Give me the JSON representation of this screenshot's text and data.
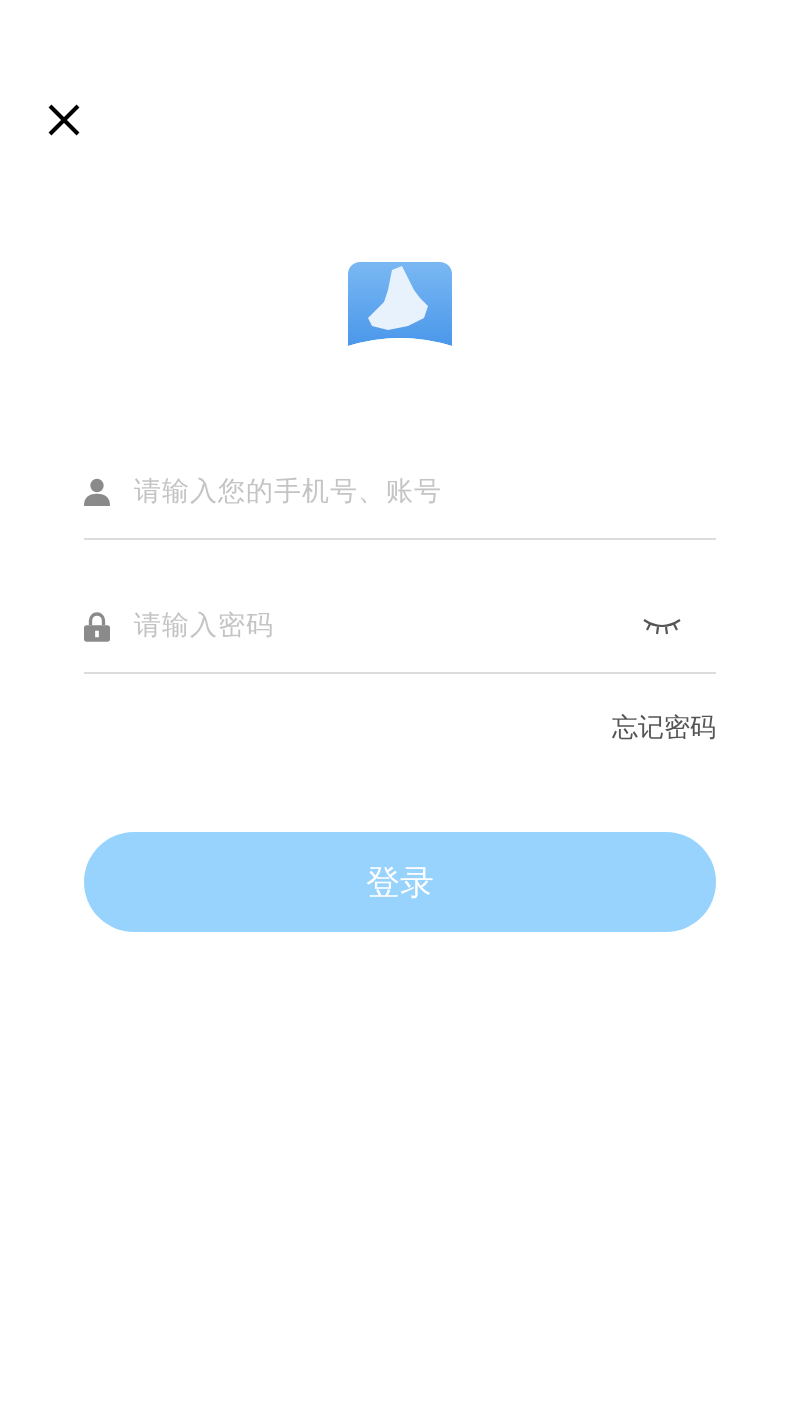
{
  "fields": [
    {
      "kind": "account",
      "placeholder": "请输入您的手机号、账号"
    },
    {
      "kind": "password",
      "placeholder": "请输入密码",
      "password_visible": false
    }
  ],
  "forgot_link": "忘记密码",
  "login_button": {
    "label": "登录",
    "disabled": true
  }
}
